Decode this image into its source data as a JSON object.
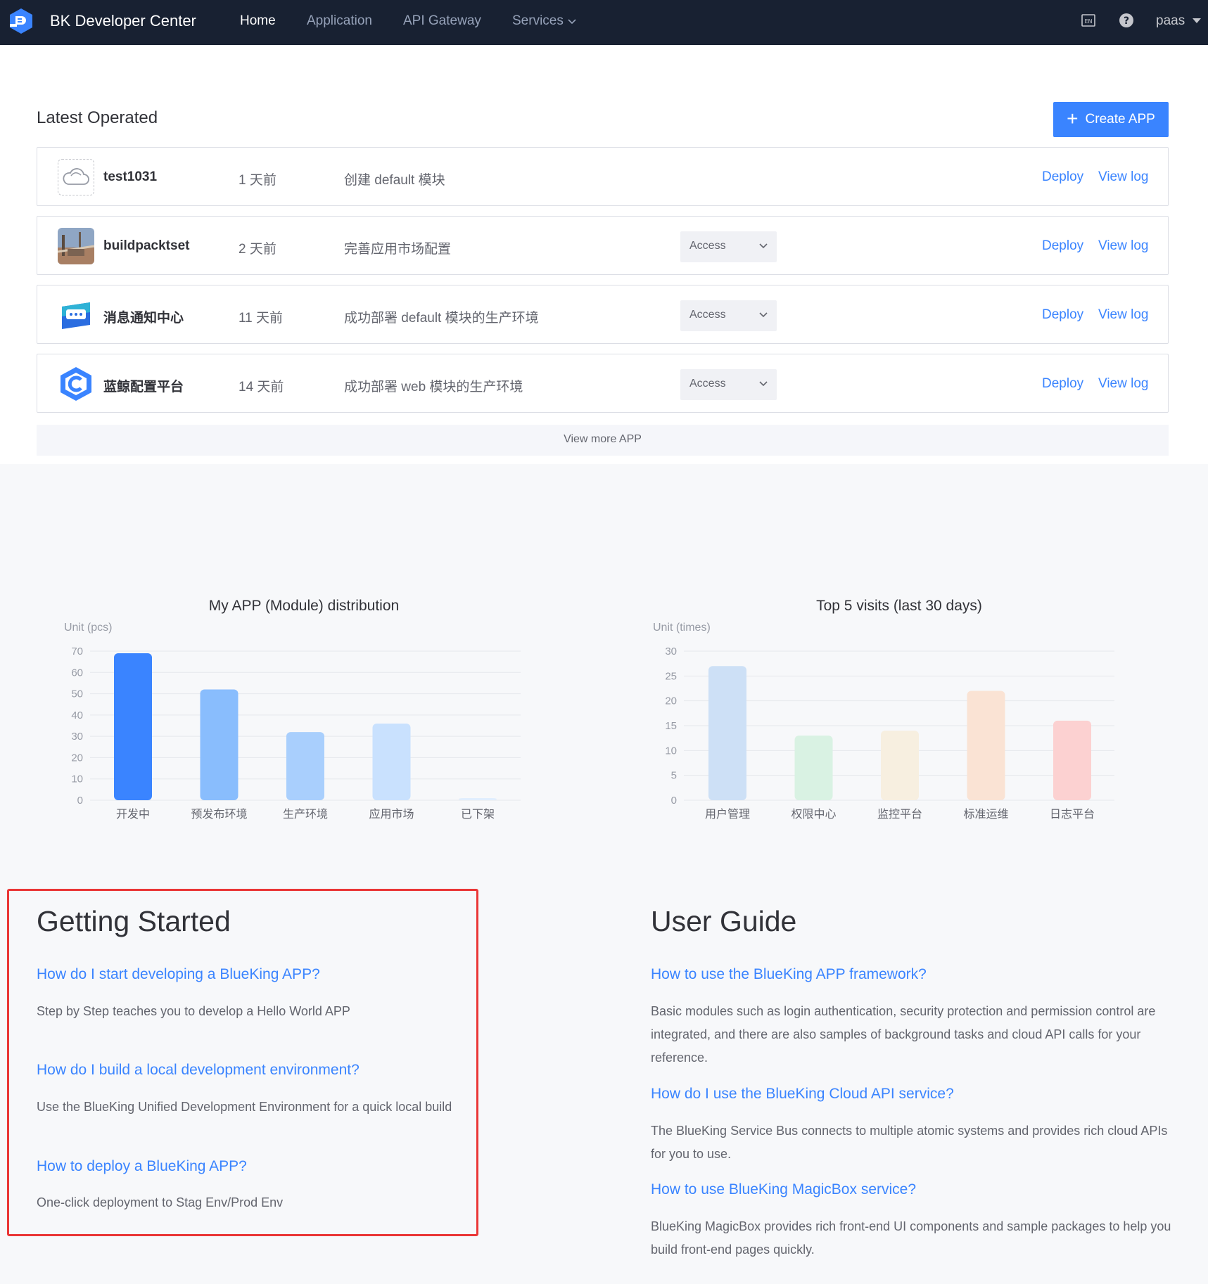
{
  "nav": {
    "brand": "BK Developer Center",
    "links": [
      "Home",
      "Application",
      "API Gateway",
      "Services"
    ],
    "user": "paas",
    "icons": [
      "bk-logo-icon",
      "language-en-icon",
      "help-icon",
      "caret-down-icon"
    ]
  },
  "latest": {
    "title": "Latest Operated",
    "create_label": "Create APP",
    "deploy_label": "Deploy",
    "viewlog_label": "View log",
    "access_label": "Access",
    "view_more": "View more APP",
    "apps": [
      {
        "name": "test1031",
        "time": "1 天前",
        "action": "创建 default 模块",
        "icon": "cloud-placeholder-icon",
        "has_access": false
      },
      {
        "name": "buildpacktset",
        "time": "2 天前",
        "action": "完善应用市场配置",
        "icon": "photo-thumbnail-icon",
        "has_access": true
      },
      {
        "name": "消息通知中心",
        "time": "11 天前",
        "action": "成功部署 default 模块的生产环境",
        "icon": "message-center-icon",
        "has_access": true
      },
      {
        "name": "蓝鲸配置平台",
        "time": "14 天前",
        "action": "成功部署 web 模块的生产环境",
        "icon": "config-platform-icon",
        "has_access": true
      }
    ]
  },
  "chart_data": [
    {
      "type": "bar",
      "title": "My APP (Module) distribution",
      "ylabel": "Unit (pcs)",
      "categories": [
        "开发中",
        "预发布环境",
        "生产环境",
        "应用市场",
        "已下架"
      ],
      "values": [
        69,
        52,
        32,
        36,
        1
      ],
      "ylim": [
        0,
        70
      ],
      "yticks": [
        0,
        10,
        20,
        30,
        40,
        50,
        60,
        70
      ],
      "colors": [
        "#3a84ff",
        "#89bdfd",
        "#a9cffd",
        "#c9e1fe",
        "#e1eefe"
      ],
      "grid": true
    },
    {
      "type": "bar",
      "title": "Top 5 visits (last 30 days)",
      "ylabel": "Unit (times)",
      "categories": [
        "用户管理",
        "权限中心",
        "监控平台",
        "标准运维",
        "日志平台"
      ],
      "values": [
        27,
        13,
        14,
        22,
        16
      ],
      "ylim": [
        0,
        30
      ],
      "yticks": [
        0,
        5,
        10,
        15,
        20,
        25,
        30
      ],
      "colors": [
        "#cde0f6",
        "#d9f2e3",
        "#f7efe0",
        "#fae3d4",
        "#fcd1d1"
      ],
      "grid": true
    }
  ],
  "getting_started": {
    "title": "Getting Started",
    "items": [
      {
        "link": "How do I start developing a BlueKing APP?",
        "desc": "Step by Step teaches you to develop a Hello World APP"
      },
      {
        "link": "How do I build a local development environment?",
        "desc": "Use the BlueKing Unified Development Environment for a quick local build"
      },
      {
        "link": "How to deploy a BlueKing APP?",
        "desc": "One-click deployment to Stag Env/Prod Env"
      }
    ]
  },
  "user_guide": {
    "title": "User Guide",
    "items": [
      {
        "link": "How to use the BlueKing APP framework?",
        "desc": "Basic modules such as login authentication, security protection and permission control are integrated, and there are also samples of background tasks and cloud API calls for your reference."
      },
      {
        "link": "How do I use the BlueKing Cloud API service?",
        "desc": "The BlueKing Service Bus connects to multiple atomic systems and provides rich cloud APIs for you to use."
      },
      {
        "link": "How to use BlueKing MagicBox service?",
        "desc": "BlueKing MagicBox provides rich front-end UI components and sample packages to help you build front-end pages quickly."
      }
    ]
  }
}
